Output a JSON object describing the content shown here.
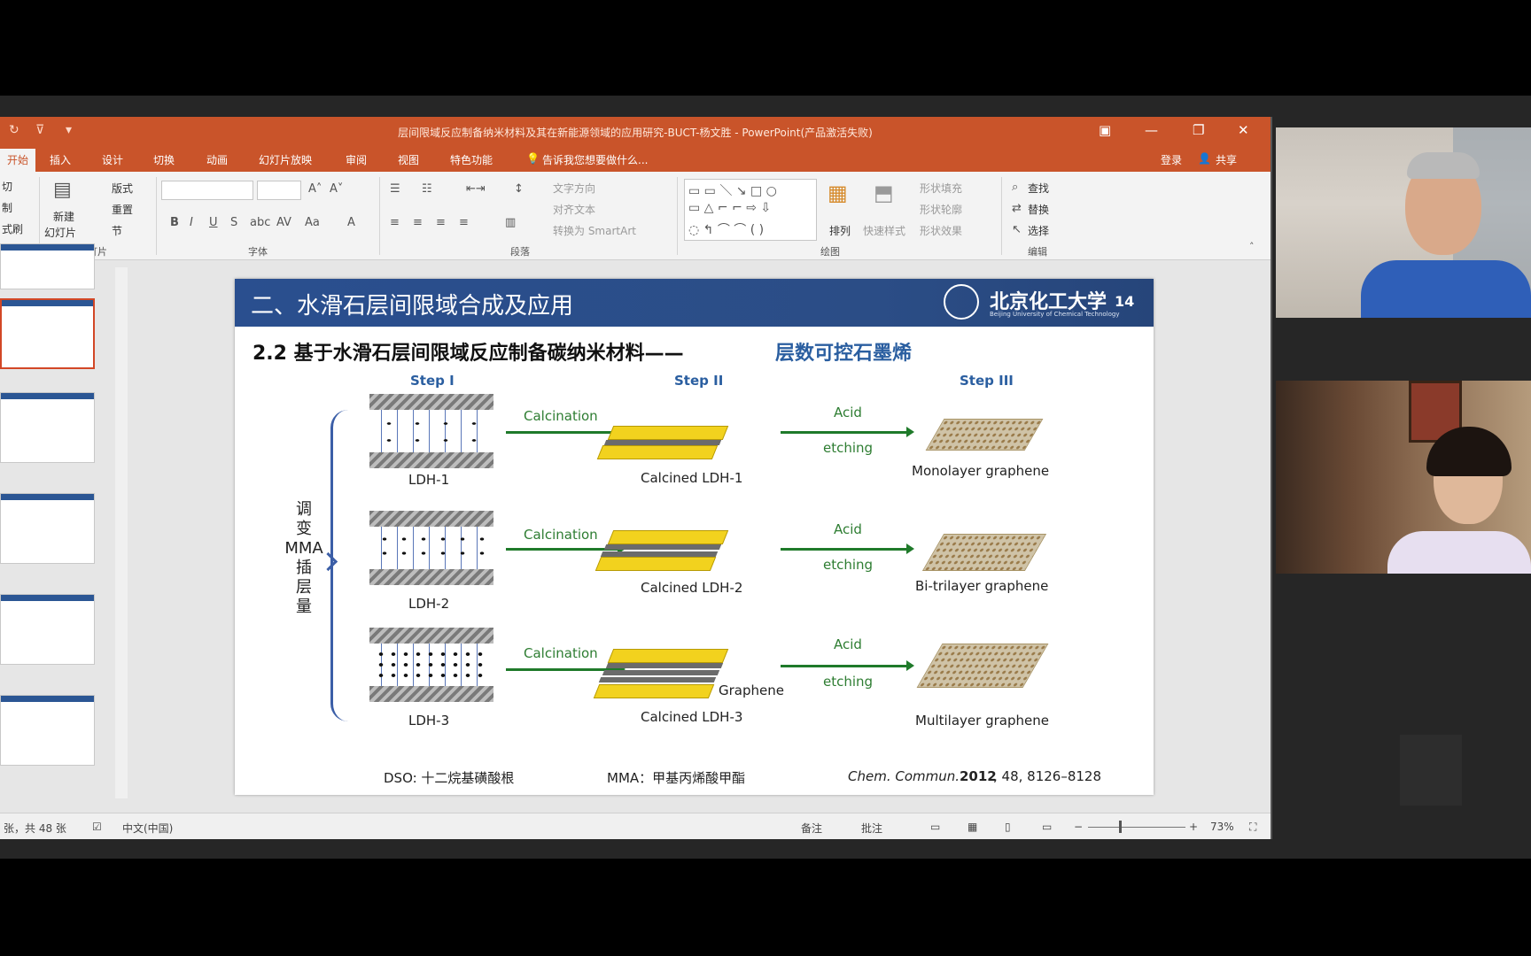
{
  "window": {
    "title": "层间限域反应制备纳米材料及其在新能源领域的应用研究-BUCT-杨文胜 - PowerPoint(产品激活失败)",
    "tabs": [
      "开始",
      "插入",
      "设计",
      "切换",
      "动画",
      "幻灯片放映",
      "审阅",
      "视图",
      "特色功能"
    ],
    "tell_me": "告诉我您想要做什么...",
    "signin": "登录",
    "share": "共享"
  },
  "ribbon": {
    "clipboard": [
      "切",
      "制",
      "式刷"
    ],
    "slides_labels": [
      "新建",
      "幻灯片",
      "版式",
      "重置",
      "节"
    ],
    "slides_group": "幻灯片",
    "font_group": "字体",
    "paragraph_group": "段落",
    "paragraph_items": [
      "文字方向",
      "对齐文本",
      "转换为 SmartArt"
    ],
    "drawing_group": "绘图",
    "drawing_items": [
      "排列",
      "快速样式",
      "形状填充",
      "形状轮廓",
      "形状效果"
    ],
    "editing_group": "编辑",
    "editing_items": [
      "查找",
      "替换",
      "选择"
    ]
  },
  "slide": {
    "header_title": "二、水滑石层间限域合成及应用",
    "university": "北京化工大学",
    "university_sub": "Beijing University of Chemical Technology",
    "page_number": "14",
    "subtitle_prefix": "2.2   基于水滑石层间限域反应制备碳纳米材料——",
    "subtitle_highlight": "层数可控石墨烯",
    "steps": [
      "Step I",
      "Step II",
      "Step III"
    ],
    "vertical_label": [
      "调",
      "变",
      "MMA",
      "插",
      "层",
      "量"
    ],
    "rows": [
      {
        "ldh": "LDH-1",
        "calc": "Calcination",
        "calcined": "Calcined  LDH-1",
        "acid": "Acid",
        "etch": "etching",
        "product": "Monolayer graphene"
      },
      {
        "ldh": "LDH-2",
        "calc": "Calcination",
        "calcined": "Calcined  LDH-2",
        "acid": "Acid",
        "etch": "etching",
        "product": "Bi-trilayer graphene"
      },
      {
        "ldh": "LDH-3",
        "calc": "Calcination",
        "calcined": "Calcined  LDH-3",
        "acid": "Acid",
        "etch": "etching",
        "product": "Multilayer graphene"
      }
    ],
    "graphene_label": "Graphene",
    "legend_dso": "DSO: 十二烷基磺酸根",
    "legend_mma": "MMA：甲基丙烯酸甲酯",
    "citation_journal": "Chem. Commun.",
    "citation_year": "2012",
    "citation_rest": ", 48, 8126–8128"
  },
  "status": {
    "slide_count": "张，共 48 张",
    "language": "中文(中国)",
    "notes": "备注",
    "comments": "批注",
    "zoom": "73%"
  },
  "colors": {
    "ppt_orange": "#c9542a",
    "slide_blue": "#2a4f8f",
    "step_blue": "#2a5ea0",
    "arrow_green": "#1f7a2a",
    "gold": "#f2d21e"
  }
}
